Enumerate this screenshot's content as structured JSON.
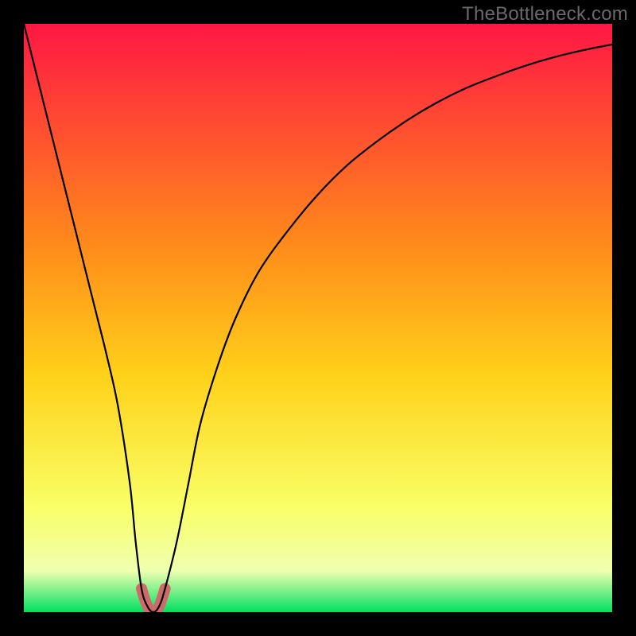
{
  "watermark": "TheBottleneck.com",
  "colors": {
    "frame": "#000000",
    "curve": "#000000",
    "highlight": "#cf6a6b",
    "grad_top": "#ff1744",
    "grad_mid_upper": "#ff8c1a",
    "grad_mid": "#ffd21a",
    "grad_mid_lower": "#f9ff66",
    "grad_pale": "#f0ffb0",
    "grad_green": "#00e060"
  },
  "chart_data": {
    "type": "line",
    "title": "",
    "xlabel": "",
    "ylabel": "",
    "xlim": [
      0,
      100
    ],
    "ylim": [
      0,
      100
    ],
    "x": [
      0,
      2,
      4,
      6,
      8,
      10,
      12,
      14,
      16,
      18,
      19,
      20,
      21,
      22,
      23,
      24,
      26,
      28,
      30,
      33,
      36,
      40,
      45,
      50,
      55,
      60,
      65,
      70,
      75,
      80,
      85,
      90,
      95,
      100
    ],
    "values": [
      100,
      92,
      84,
      76,
      68,
      60,
      52,
      44,
      35,
      22,
      12,
      4,
      1,
      0,
      1,
      4,
      12,
      22,
      32,
      42,
      50,
      58,
      65,
      71,
      76,
      80,
      83.5,
      86.5,
      89,
      91,
      92.8,
      94.3,
      95.5,
      96.5
    ],
    "highlight_x_range": [
      19.5,
      24.5
    ],
    "highlight_y_max": 5
  }
}
